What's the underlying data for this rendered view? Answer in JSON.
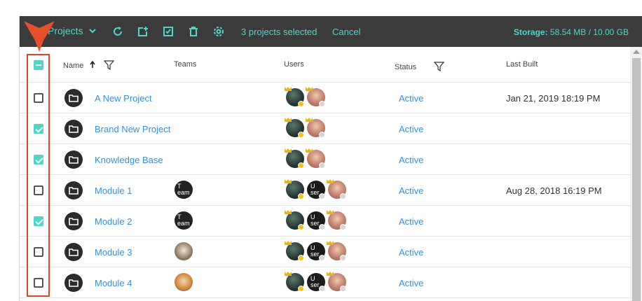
{
  "toolbar": {
    "projects_label": "Projects",
    "selected_text": "3 projects selected",
    "cancel_label": "Cancel",
    "storage_label": "Storage:",
    "storage_value": "58.54 MB / 10.00 GB"
  },
  "columns": {
    "name": "Name",
    "teams": "Teams",
    "users": "Users",
    "status": "Status",
    "last_built": "Last Built"
  },
  "rows": [
    {
      "name": "A New Project",
      "status": "Active",
      "last_built": "Jan 21, 2019 18:19 PM",
      "checked": false
    },
    {
      "name": "Brand New Project",
      "status": "Active",
      "last_built": "",
      "checked": true
    },
    {
      "name": "Knowledge Base",
      "status": "Active",
      "last_built": "",
      "checked": true
    },
    {
      "name": "Module 1",
      "status": "Active",
      "last_built": "Aug 28, 2018 16:19 PM",
      "checked": false,
      "team_alt": "T eam"
    },
    {
      "name": "Module 2",
      "status": "Active",
      "last_built": "",
      "checked": true,
      "team_alt": "T eam"
    },
    {
      "name": "Module 3",
      "status": "Active",
      "last_built": "",
      "checked": false
    },
    {
      "name": "Module 4",
      "status": "Active",
      "last_built": "",
      "checked": false
    }
  ],
  "user_alt": "U ser",
  "colors": {
    "accent": "#4fd6c6",
    "link": "#3d8fcf",
    "toolbar_bg": "#3b3b3b",
    "highlight": "#d9472b"
  }
}
